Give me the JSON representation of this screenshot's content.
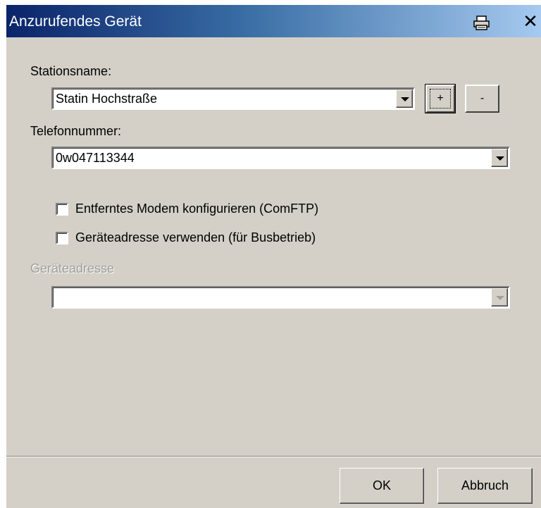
{
  "window": {
    "title": "Anzurufendes Gerät",
    "close_glyph": "✕"
  },
  "station": {
    "label": "Stationsname:",
    "value": "Statin Hochstraße",
    "add_label": "+",
    "remove_label": "-"
  },
  "phone": {
    "label": "Telefonnummer:",
    "value": "0w047113344"
  },
  "options": {
    "remote_modem": "Entferntes Modem konfigurieren (ComFTP)",
    "device_address_use": "Geräteadresse verwenden (für Busbetrieb)"
  },
  "device_address": {
    "label": "Geräteadresse",
    "value": ""
  },
  "buttons": {
    "ok": "OK",
    "cancel": "Abbruch"
  },
  "icons": {
    "print": "printer-icon",
    "close": "close-icon",
    "dropdown": "chevron-down-icon"
  }
}
